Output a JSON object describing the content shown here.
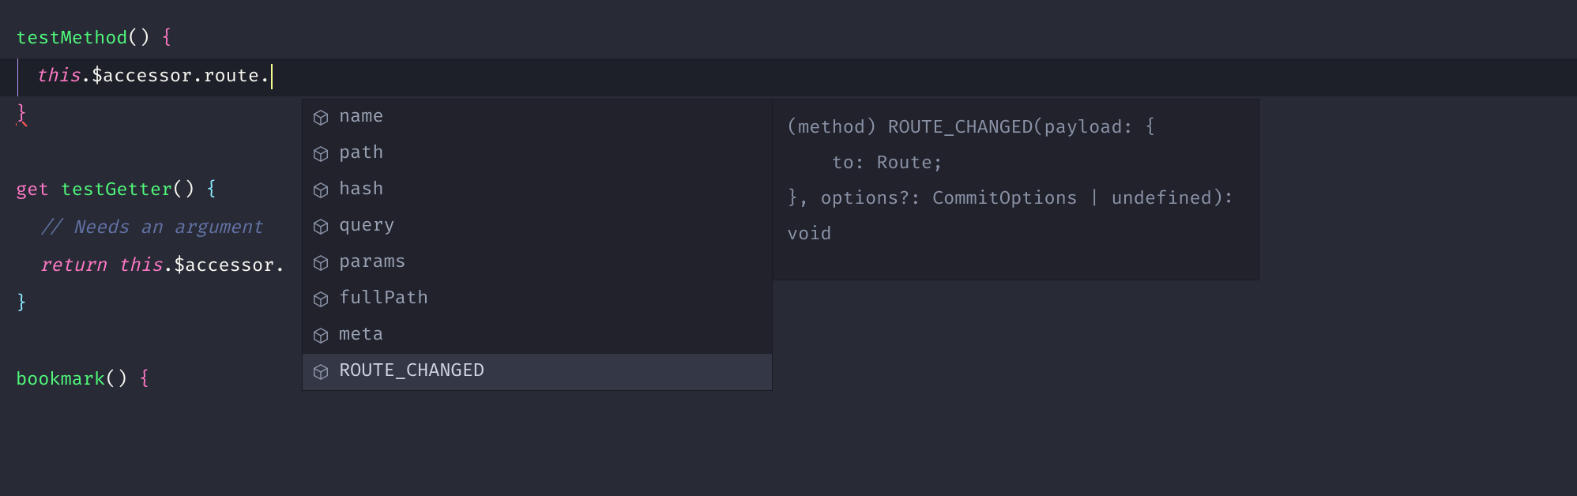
{
  "code": {
    "line1_fn": "testMethod",
    "line1_parens": "()",
    "line1_brace": " {",
    "line2_this": "this",
    "line2_rest": ".$accessor.route.",
    "line3_brace": "}",
    "getter_kw": "get",
    "getter_name": " testGetter",
    "getter_parens": "()",
    "getter_brace": " {",
    "comment": "// Needs an argument",
    "return_kw": "return",
    "return_this": " this",
    "return_rest": ".$accessor.",
    "close_brace": "}",
    "bookmark_fn": "bookmark",
    "bookmark_parens": "()",
    "bookmark_brace": " {"
  },
  "suggestions": [
    {
      "label": "name",
      "kind": "field",
      "selected": false
    },
    {
      "label": "path",
      "kind": "field",
      "selected": false
    },
    {
      "label": "hash",
      "kind": "field",
      "selected": false
    },
    {
      "label": "query",
      "kind": "field",
      "selected": false
    },
    {
      "label": "params",
      "kind": "field",
      "selected": false
    },
    {
      "label": "fullPath",
      "kind": "field",
      "selected": false
    },
    {
      "label": "meta",
      "kind": "field",
      "selected": false
    },
    {
      "label": "ROUTE_CHANGED",
      "kind": "method",
      "selected": true
    }
  ],
  "docs": "(method) ROUTE_CHANGED(payload: {\n    to: Route;\n}, options?: CommitOptions | undefined): void",
  "colors": {
    "bg": "#282a36",
    "widget_bg": "#21222c",
    "selected_bg": "#343746",
    "pink": "#ff79c6",
    "green": "#50fa7b",
    "comment": "#6272a4",
    "icon": "#8b93a7"
  }
}
